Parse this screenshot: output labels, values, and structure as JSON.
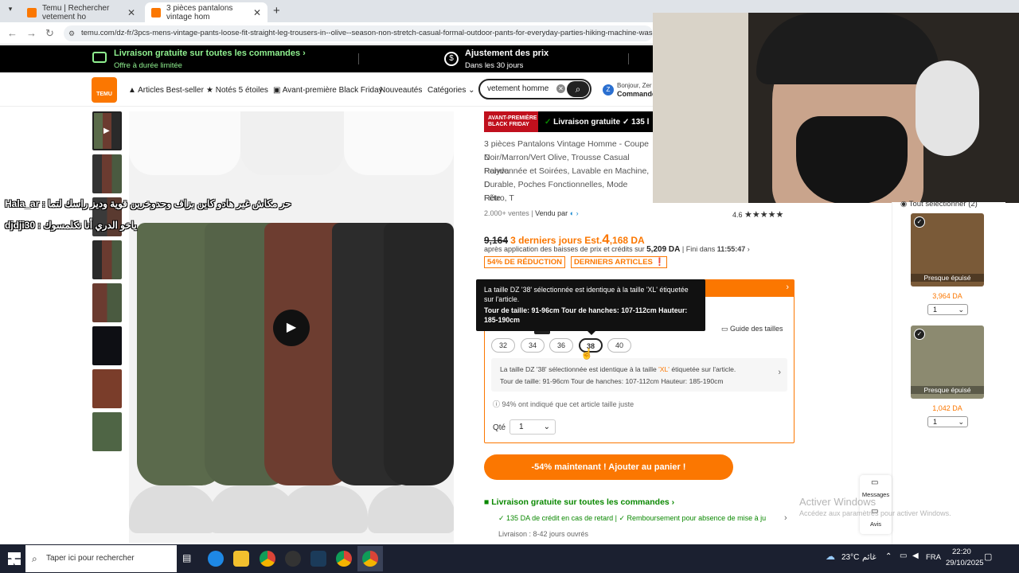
{
  "browser": {
    "tabs": [
      {
        "label": "Temu | Rechercher vetement ho"
      },
      {
        "label": "3 pièces pantalons vintage hom"
      }
    ],
    "url": "temu.com/dz-fr/3pcs-mens-vintage-pants-loose-fit-straight-leg-trousers-in--olive--season-non-stretch-casual-formal-outdoor-pants-for-everyday-parties-hiking-machine-wash"
  },
  "promo": {
    "item1": {
      "title": "Livraison gratuite sur toutes les commandes",
      "sub": "Offre à durée limitée"
    },
    "item2": {
      "title": "Ajustement des prix",
      "sub": "Dans les 30 jours"
    }
  },
  "header": {
    "logo": "TEMU",
    "nav": [
      "Articles Best-seller",
      "Notés 5 étoiles",
      "Avant-première Black Friday",
      "Nouveautés",
      "Catégories"
    ],
    "search_value": "vetement homme",
    "account_line1": "Bonjour, Zer",
    "account_line2": "Commande"
  },
  "chat": {
    "line1": "Hala_ar : حر مكاش غير هادو كاين بزاف وحدوخرين قوية وديز راسك لتما",
    "line2": "djdji30 : ياخو الدري أنا نكلمسوك"
  },
  "product": {
    "badge_black_friday": "AVANT-PREMIÈRE BLACK FRIDAY",
    "badge_shipping": "Livraison gratuite",
    "badge_count": "135 l",
    "title_lines": [
      "3 pièces Pantalons Vintage Homme - Coupe D",
      "Noir/Marron/Vert Olive, Trousse Casual Polyva",
      "Randonnée et Soirées, Lavable en Machine, D",
      "Durable, Poches Fonctionnelles, Mode Rétro, T",
      "Fête"
    ],
    "sales": "2.000+ ventes",
    "sold_by": "Vendu par",
    "rating": "4.6",
    "price_old": "9,164",
    "price_promo_label": "3 derniers jours",
    "price_est_label": "Est.",
    "price_est_big": "4",
    "price_est_rest": ",168 DA",
    "price_after_text": "après application des baisses de prix et crédits sur",
    "price_after_value": "5,209 DA",
    "ends_in": "Fini dans",
    "countdown": "11:55:47",
    "discount_tag": "54% DE RÉDUCTION",
    "last_items_tag": "DERNIERS ARTICLES",
    "tooltip_line1": "La taille DZ '38' sélectionnée est identique à la taille 'XL' étiquetée sur l'article.",
    "tooltip_line2": "Tour de taille: 91-96cm Tour de hanches: 107-112cm Hauteur: 185-190cm",
    "size_tab": "DZ",
    "size_guide": "Guide des tailles",
    "sizes": [
      "32",
      "34",
      "36",
      "38",
      "40"
    ],
    "selected_size": "38",
    "size_info_line1_a": "La taille DZ '38' sélectionnée est identique à la taille ",
    "size_info_line1_b": "'XL'",
    "size_info_line1_c": " étiquetée sur l'article.",
    "size_info_line2": "Tour de taille: 91-96cm Tour de hanches: 107-112cm Hauteur: 185-190cm",
    "fit_note": "94% ont indiqué que cet article taille juste",
    "qty_label": "Qté",
    "qty_value": "1",
    "cart_button": "-54% maintenant ! Ajouter au panier !",
    "shipping_title": "Livraison gratuite sur toutes les commandes",
    "credit_text": "135 DA de crédit en cas de retard",
    "refund_text": "Remboursement pour absence de mise à ju",
    "delivery_text": "Livraison : 8-42 jours ouvrés"
  },
  "cart_panel": {
    "select_all": "Tout sélectionner (2)",
    "items": [
      {
        "label": "Presque épuisé",
        "price": "3,964 DA",
        "qty": "1"
      },
      {
        "label": "Presque épuisé",
        "price": "1,042 DA",
        "qty": "1"
      }
    ]
  },
  "float": {
    "messages": "Messages",
    "reviews": "Avis"
  },
  "watermark": {
    "line1": "Activer Windows",
    "line2": "Accédez aux paramètres pour activer Windows."
  },
  "taskbar": {
    "search_placeholder": "Taper ici pour rechercher",
    "weather": "23°C",
    "weather_label": "غائم",
    "lang": "FRA",
    "time": "22:20",
    "date": "29/10/2025"
  },
  "colors": {
    "temu_orange": "#fb7701",
    "price_orange": "#fb7701",
    "green": "#0a8800",
    "tooltip_bg": "#111111"
  }
}
